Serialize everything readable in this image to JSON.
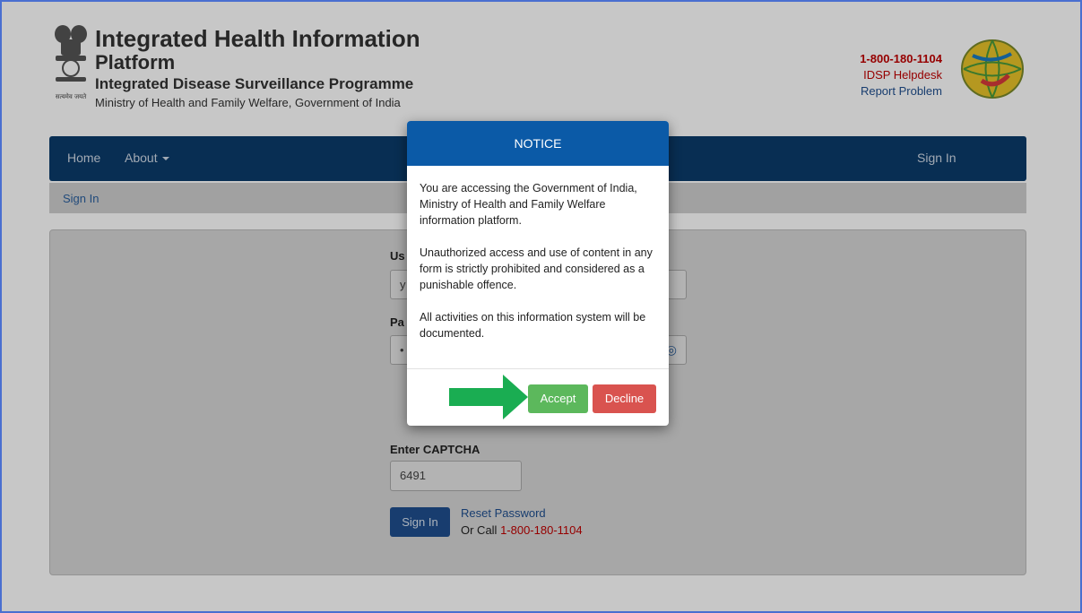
{
  "header": {
    "title_line1": "Integrated Health Information",
    "title_line2": "Platform",
    "subtitle": "Integrated Disease Surveillance Programme",
    "ministry": "Ministry of Health and Family Welfare, Government of India",
    "emblem_motto": "सत्यमेव जयते",
    "helpline_number": "1-800-180-1104",
    "helpdesk_label": "IDSP Helpdesk",
    "report_label": "Report Problem"
  },
  "navbar": {
    "home": "Home",
    "about": "About",
    "signin": "Sign In"
  },
  "breadcrumb": {
    "current": "Sign In"
  },
  "form": {
    "username_label_partial": "Us",
    "username_value_partial": "y",
    "password_label_partial": "Pa",
    "password_value_partial": "•",
    "captcha_label": "Enter CAPTCHA",
    "captcha_value": "6491",
    "signin_button": "Sign In",
    "reset_password": "Reset Password",
    "or_call_prefix": "Or Call ",
    "or_call_number": "1-800-180-1104"
  },
  "modal": {
    "title": "NOTICE",
    "paragraph1": "You are accessing the Government of India, Ministry of Health and Family Welfare information platform.",
    "paragraph2": "Unauthorized access and use of content in any form is strictly prohibited and considered as a punishable offence.",
    "paragraph3": "All activities on this information system will be documented.",
    "accept_button": "Accept",
    "decline_button": "Decline"
  },
  "colors": {
    "navbar": "#0b3b6b",
    "modal_header": "#0b5aa7",
    "accept": "#5cb85c",
    "decline": "#d9534f",
    "helpline_red": "#c00000",
    "annotation_arrow": "#1aad52"
  },
  "icons": {
    "emblem": "national-emblem-icon",
    "globe": "idsp-globe-logo-icon",
    "caret": "caret-down-icon",
    "eye": "eye-toggle-icon",
    "arrow": "annotation-arrow-icon"
  }
}
